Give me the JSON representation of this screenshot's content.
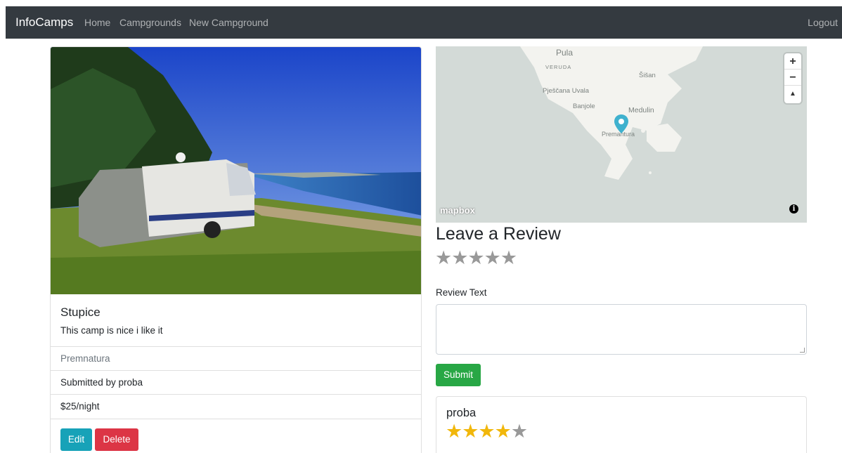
{
  "navbar": {
    "brand": "InfoCamps",
    "links": [
      "Home",
      "Campgrounds",
      "New Campground"
    ],
    "logout": "Logout"
  },
  "campground": {
    "title": "Stupice",
    "description": "This camp is nice i like it",
    "location": "Premnatura",
    "submitted_by": "Submitted by proba",
    "price": "$25/night",
    "edit_label": "Edit",
    "delete_label": "Delete"
  },
  "map": {
    "labels": [
      "Pula",
      "VERUDA",
      "Šišan",
      "Pješčana Uvala",
      "Banjole",
      "Medulin",
      "Premantura"
    ],
    "zoom_in": "+",
    "zoom_out": "−",
    "compass": "▲",
    "attribution": "mapbox",
    "info": "i"
  },
  "review_form": {
    "heading": "Leave a Review",
    "rating_stars": "★★★★★",
    "text_label": "Review Text",
    "text_value": "",
    "submit_label": "Submit"
  },
  "reviews": [
    {
      "author": "proba",
      "rating": 4,
      "stars_on": "★★★★",
      "stars_off": "★"
    }
  ],
  "colors": {
    "navbar": "#343a40",
    "edit": "#17a2b8",
    "delete": "#dc3545",
    "submit": "#28a745",
    "star": "#f1b70b",
    "marker": "#3fb1ce"
  }
}
